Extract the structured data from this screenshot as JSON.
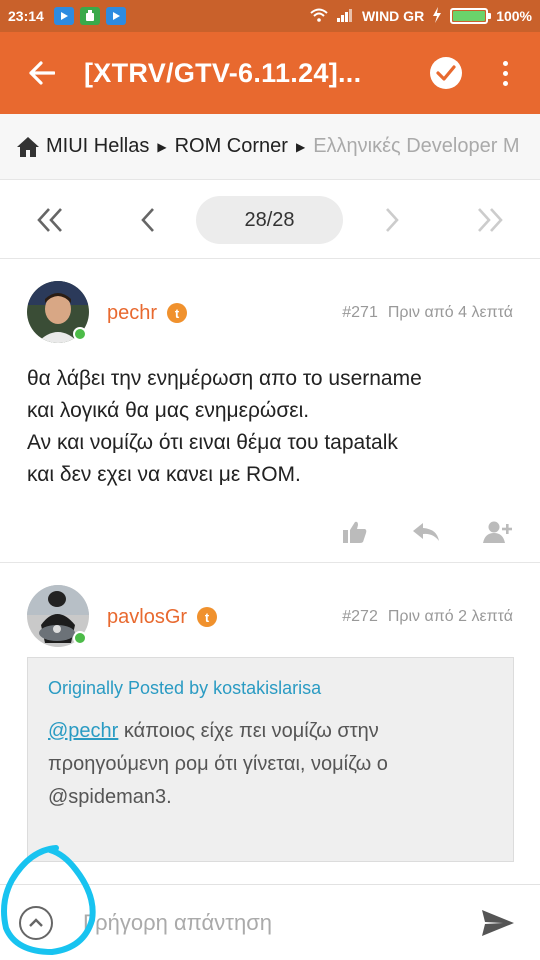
{
  "status_bar": {
    "time": "23:14",
    "carrier": "WIND GR",
    "battery": "100%",
    "battery_level": 1.0,
    "icons": [
      "youtube-icon",
      "android-icon",
      "youtube-icon",
      "wifi-icon",
      "signal-icon",
      "charging-icon",
      "battery-icon"
    ]
  },
  "app_bar": {
    "title": "[XTRV/GTV-6.11.24]...",
    "icons": [
      "back-arrow-icon",
      "check-circle-icon",
      "more-vert-icon"
    ]
  },
  "breadcrumb": {
    "items": [
      "MIUI Hellas",
      "ROM Corner",
      "Ελληνικές Developer M"
    ]
  },
  "pagination": {
    "label": "28/28",
    "current": 28,
    "total": 28
  },
  "posts": [
    {
      "username": "pechr",
      "badge": "t",
      "number": "#271",
      "time": "Πριν από 4 λεπτά",
      "lines": [
        "θα λάβει την ενημέρωση απο το username",
        "και λογικά θα μας ενημερώσει.",
        "Αν και νομίζω ότι ειναι θέμα του tapatalk",
        "και δεν εχει να κανει με ROM."
      ],
      "online": true
    },
    {
      "username": "pavlosGr",
      "badge": "t",
      "number": "#272",
      "time": "Πριν από 2 λεπτά",
      "online": true,
      "quote": {
        "header": "Originally Posted by kostakislarisa",
        "mention": "@pechr",
        "text_after_mention": " κάποιος είχε πει νομίζω στην",
        "line2": "προηγούμενη ρομ ότι γίνεται, νομίζω ο",
        "line3": "@spideman3."
      }
    }
  ],
  "reply_bar": {
    "placeholder": "Γρήγορη απάντηση"
  },
  "colors": {
    "status_bar": "#c9612b",
    "app_bar": "#e8692f",
    "username": "#e8692f",
    "link": "#2a9bc3",
    "online": "#4cbb48",
    "annotation_stroke": "#18c3f0"
  }
}
